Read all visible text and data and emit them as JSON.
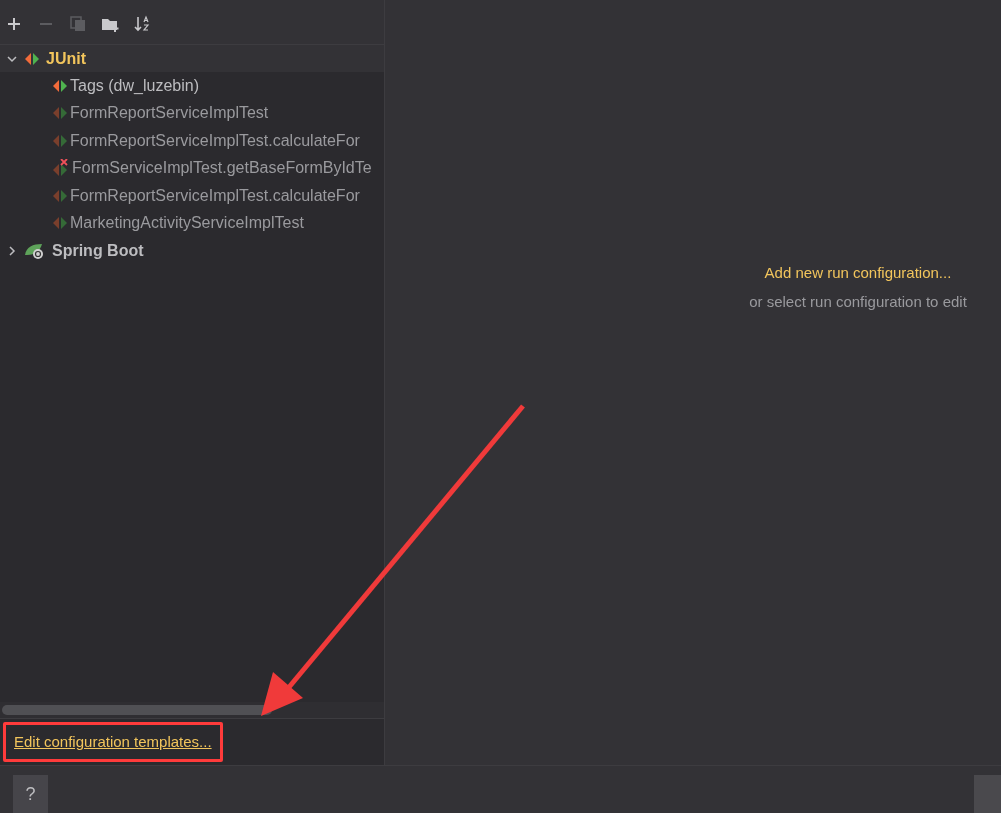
{
  "toolbar": {
    "buttons": [
      {
        "kind": "add",
        "disabled": false
      },
      {
        "kind": "remove",
        "disabled": true
      },
      {
        "kind": "copy",
        "disabled": true
      },
      {
        "kind": "folder",
        "disabled": false
      },
      {
        "kind": "sort",
        "disabled": false
      }
    ]
  },
  "tree": [
    {
      "label": "JUnit",
      "kind": "junit",
      "expanded": true,
      "selected": true,
      "children": [
        {
          "label": "Tags (dw_luzebin)",
          "kind": "junit"
        },
        {
          "label": "FormReportServiceImplTest",
          "kind": "junit-dim"
        },
        {
          "label": "FormReportServiceImplTest.calculateFor",
          "kind": "junit-dim"
        },
        {
          "label": "FormServiceImplTest.getBaseFormByIdTe",
          "kind": "junit-error"
        },
        {
          "label": "FormReportServiceImplTest.calculateFor",
          "kind": "junit-dim"
        },
        {
          "label": "MarketingActivityServiceImplTest",
          "kind": "junit-dim"
        }
      ]
    },
    {
      "label": "Spring Boot",
      "kind": "spring",
      "expanded": false,
      "selected": false
    }
  ],
  "templates_link": "Edit configuration templates...",
  "empty_state": {
    "link": "Add new run configuration...",
    "hint": "or select run configuration to edit"
  },
  "help_button": "?"
}
